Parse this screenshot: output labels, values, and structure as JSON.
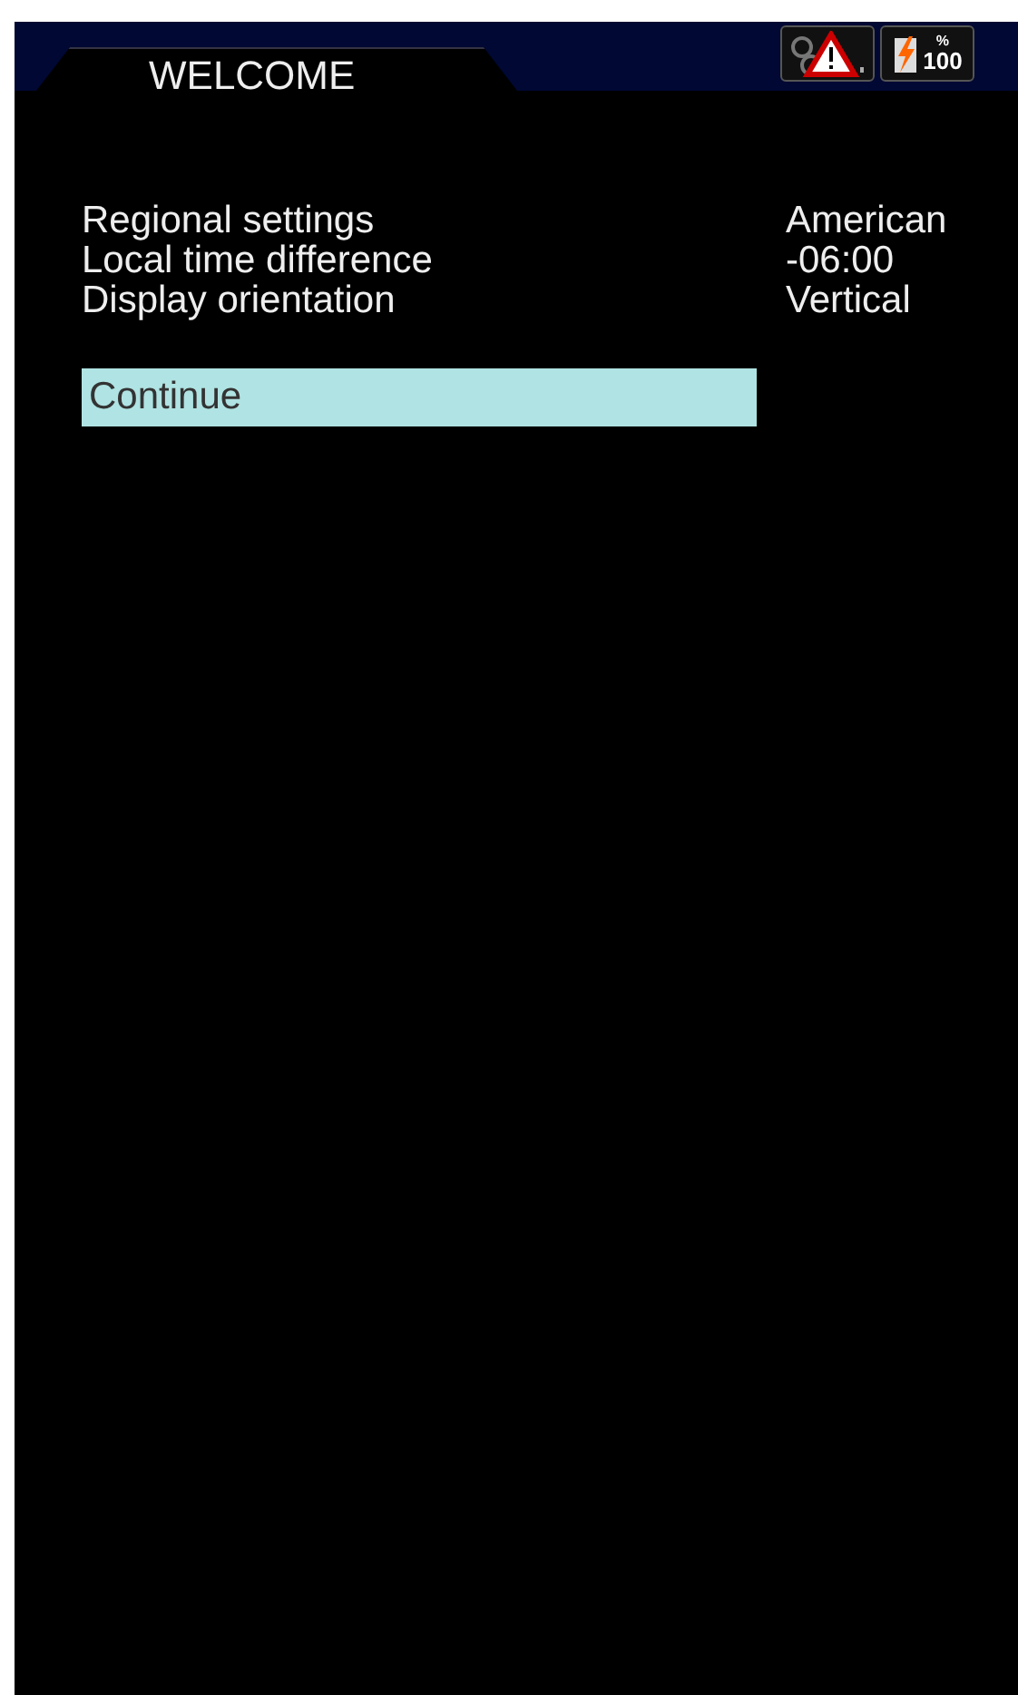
{
  "header": {
    "title": "WELCOME",
    "battery": {
      "unit": "%",
      "reading": "100"
    }
  },
  "settings": [
    {
      "label": "Regional settings",
      "value": "American"
    },
    {
      "label": "Local time difference",
      "value": "-06:00"
    },
    {
      "label": "Display orientation",
      "value": "Vertical"
    }
  ],
  "menu": [
    {
      "label": "Continue",
      "selected": true
    }
  ]
}
